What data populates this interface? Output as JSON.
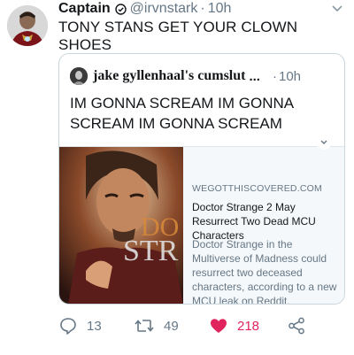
{
  "tweet": {
    "display_name": "Captain",
    "handle": "@irvnstark",
    "separator": "·",
    "time": "10h",
    "text": "TONY STANS GET YOUR CLOWN SHOES"
  },
  "quoted_tweet": {
    "display_name": "jake gyllenhaal's cumslut",
    "ellipsis": "...",
    "separator": "·",
    "time": "10h",
    "text": "IM GONNA SCREAM IM GONNA SCREAM IM GONNA SCREAM"
  },
  "link_card": {
    "domain": "WEGOTTHISCOVERED.COM",
    "title": "Doctor Strange 2 May Resurrect Two Dead MCU Characters",
    "description": "Doctor Strange in the Multiverse of Madness could resurrect two deceased characters, according to a new MCU leak on Reddit.",
    "image_text": "DOCTOR STRANGE"
  },
  "actions": {
    "replies": "13",
    "retweets": "49",
    "likes": "218"
  },
  "colors": {
    "text": "#14171a",
    "secondary": "#657786",
    "like": "#e0245e",
    "border": "#ccd6dd"
  },
  "icons": [
    "verified-badge-icon",
    "chevron-down-icon",
    "reply-icon",
    "retweet-icon",
    "heart-icon",
    "share-icon"
  ]
}
